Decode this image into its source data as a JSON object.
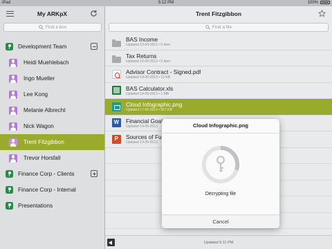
{
  "status_bar": {
    "device": "iPad",
    "time": "5:12 PM",
    "battery": "100%"
  },
  "sidebar": {
    "title": "My ARKpX",
    "search_placeholder": "Find a box",
    "groups": [
      {
        "label": "Development Team",
        "expanded": true,
        "members": [
          {
            "name": "Heidi Muehlebach"
          },
          {
            "name": "Ingo Mueller"
          },
          {
            "name": "Lee Kong"
          },
          {
            "name": "Melanie Albrecht"
          },
          {
            "name": "Nick Wagon"
          },
          {
            "name": "Trent Fitzgibbon",
            "selected": true
          },
          {
            "name": "Trevor Horsfall"
          }
        ]
      },
      {
        "label": "Finance Corp - Clients",
        "expanded": false
      },
      {
        "label": "Finance Corp - Internal"
      },
      {
        "label": "Presentations"
      }
    ]
  },
  "main": {
    "title": "Trent Fitzgibbon",
    "search_placeholder": "Find a file",
    "files": [
      {
        "name": "BAS Income",
        "meta": "Updated 10-04-2013 • 0 item",
        "type": "folder"
      },
      {
        "name": "Tax Returns",
        "meta": "Updated 10-04-2013 • 0 item",
        "type": "folder"
      },
      {
        "name": "Advisor Contract - Signed.pdf",
        "meta": "Updated 14-09-2013 • 13 KB",
        "type": "pdf"
      },
      {
        "name": "BAS Calculator.xls",
        "meta": "Updated 14-09-2013 • 1 MB",
        "type": "xls"
      },
      {
        "name": "Cloud Infographic.png",
        "meta": "Updated 17-09-2013 • 557 KB",
        "type": "png",
        "selected": true
      },
      {
        "name": "Financial Goals Worksheet.doc",
        "meta": "Updated 14-09-2013",
        "type": "doc"
      },
      {
        "name": "Sources of Funds.ppt",
        "meta": "Updated 14-09-2013",
        "type": "ppt"
      }
    ],
    "footer_text": "Updated 5:11 PM"
  },
  "modal": {
    "title": "Cloud Infographic.png",
    "message": "Decrypting file",
    "cancel_label": "Cancel",
    "progress": 0.3
  },
  "colors": {
    "accent": "#9aaa2c",
    "avatar": "#b679d6",
    "box": "#2b8a4b"
  }
}
